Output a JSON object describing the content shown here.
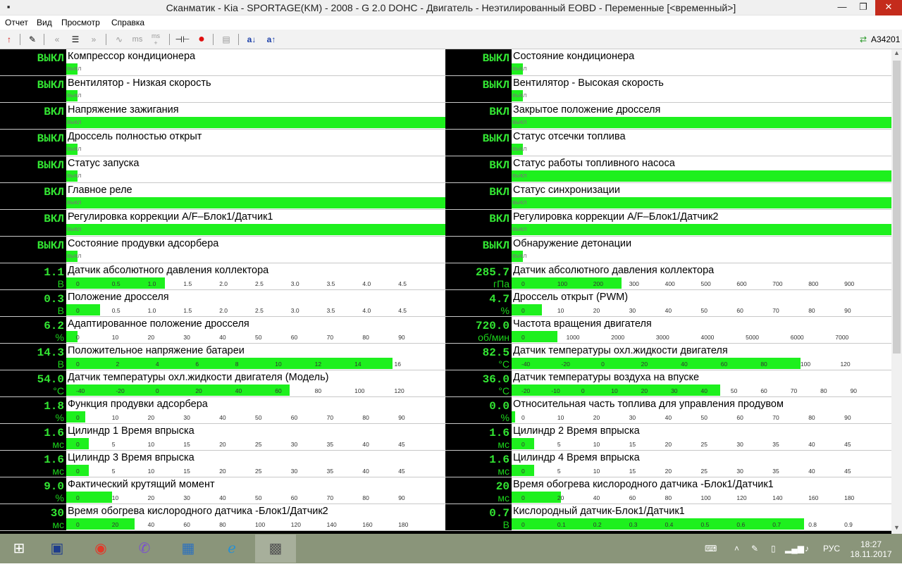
{
  "window": {
    "title": "Сканматик - Kia - SPORTAGE(KM) - 2008 - G 2.0 DOHC - Двигатель - Неэтилированный EOBD - Переменные [<временный>]"
  },
  "menu": [
    "Отчет",
    "Вид",
    "Просмотр",
    "Справка"
  ],
  "toolbar": {
    "icons": [
      "back-arrow-icon",
      "edit-icon",
      "rewind-icon",
      "list-icon",
      "forward-icon",
      "wave-icon",
      "ms-icon",
      "ms-plus-icon",
      "connector-icon",
      "record-icon",
      "save-icon",
      "sort-down-icon",
      "sort-up-icon"
    ],
    "ms_label": "ms",
    "ms_plus_label": "ms\n+",
    "sort_down_label": "a↓",
    "sort_up_label": "a↑",
    "device_id": "A34201"
  },
  "colors": {
    "value_green": "#33e633",
    "bar_green": "#1ef01e",
    "panel_bg": "#000000"
  },
  "left": [
    {
      "value": "ВЫКЛ",
      "unit": "",
      "label": "Компрессор кондиционера",
      "type": "bool",
      "level": 0.03,
      "state": "выкл"
    },
    {
      "value": "ВЫКЛ",
      "unit": "",
      "label": "Вентилятор - Низкая скорость",
      "type": "bool",
      "level": 0.03,
      "state": "выкл"
    },
    {
      "value": "ВКЛ",
      "unit": "",
      "label": "Напряжение зажигания",
      "type": "bool",
      "level": 1,
      "state": "выкл"
    },
    {
      "value": "ВЫКЛ",
      "unit": "",
      "label": "Дроссель полностью открыт",
      "type": "bool",
      "level": 0.03,
      "state": "выкл"
    },
    {
      "value": "ВЫКЛ",
      "unit": "",
      "label": "Статус запуска",
      "type": "bool",
      "level": 0.03,
      "state": "выкл"
    },
    {
      "value": "ВКЛ",
      "unit": "",
      "label": "Главное реле",
      "type": "bool",
      "level": 1,
      "state": "выкл"
    },
    {
      "value": "ВКЛ",
      "unit": "",
      "label": "Регулировка коррекции A/F–Блок1/Датчик1",
      "type": "bool",
      "level": 1,
      "state": "выкл"
    },
    {
      "value": "ВЫКЛ",
      "unit": "",
      "label": "Состояние продувки адсорбера",
      "type": "bool",
      "level": 0.03,
      "state": "выкл"
    },
    {
      "value": "1.1",
      "unit": "В",
      "label": "Датчик абсолютного давления коллектора",
      "type": "scale",
      "level": 0.26,
      "ticks": [
        "0",
        "0.5",
        "1.0",
        "1.5",
        "2.0",
        "2.5",
        "3.0",
        "3.5",
        "4.0",
        "4.5"
      ]
    },
    {
      "value": "0.3",
      "unit": "В",
      "label": "Положение дросселя",
      "type": "scale",
      "level": 0.09,
      "ticks": [
        "0",
        "0.5",
        "1.0",
        "1.5",
        "2.0",
        "2.5",
        "3.0",
        "3.5",
        "4.0",
        "4.5"
      ]
    },
    {
      "value": "6.2",
      "unit": "%",
      "label": "Адаптированное положение дросселя",
      "type": "scale",
      "level": 0.03,
      "ticks": [
        "0",
        "10",
        "20",
        "30",
        "40",
        "50",
        "60",
        "70",
        "80",
        "90"
      ]
    },
    {
      "value": "14.3",
      "unit": "В",
      "label": "Положительное напряжение батареи",
      "type": "scale",
      "level": 0.86,
      "ticks": [
        "0",
        "2",
        "4",
        "6",
        "8",
        "10",
        "12",
        "14",
        "16"
      ]
    },
    {
      "value": "54.0",
      "unit": "°C",
      "label": "Датчик температуры охл.жидкости двигателя (Модель)",
      "type": "scale",
      "level": 0.59,
      "ticks": [
        "-40",
        "-20",
        "0",
        "20",
        "40",
        "60",
        "80",
        "100",
        "120"
      ]
    },
    {
      "value": "1.8",
      "unit": "%",
      "label": "Функция продувки адсорбера",
      "type": "scale",
      "level": 0.05,
      "ticks": [
        "0",
        "10",
        "20",
        "30",
        "40",
        "50",
        "60",
        "70",
        "80",
        "90"
      ]
    },
    {
      "value": "1.6",
      "unit": "мс",
      "label": "Цилиндр 1 Время впрыска",
      "type": "scale",
      "level": 0.06,
      "ticks": [
        "0",
        "5",
        "10",
        "15",
        "20",
        "25",
        "30",
        "35",
        "40",
        "45"
      ]
    },
    {
      "value": "1.6",
      "unit": "мс",
      "label": "Цилиндр 3 Время впрыска",
      "type": "scale",
      "level": 0.06,
      "ticks": [
        "0",
        "5",
        "10",
        "15",
        "20",
        "25",
        "30",
        "35",
        "40",
        "45"
      ]
    },
    {
      "value": "9.0",
      "unit": "%",
      "label": "Фактический крутящий момент",
      "type": "scale",
      "level": 0.12,
      "ticks": [
        "0",
        "10",
        "20",
        "30",
        "40",
        "50",
        "60",
        "70",
        "80",
        "90"
      ]
    },
    {
      "value": "30",
      "unit": "мс",
      "label": "Время обогрева кислородного датчика -Блок1/Датчик2",
      "type": "scale",
      "level": 0.18,
      "ticks": [
        "0",
        "20",
        "40",
        "60",
        "80",
        "100",
        "120",
        "140",
        "160",
        "180"
      ]
    }
  ],
  "right": [
    {
      "value": "ВЫКЛ",
      "unit": "",
      "label": "Состояние кондиционера",
      "type": "bool",
      "level": 0.03,
      "state": "выкл"
    },
    {
      "value": "ВЫКЛ",
      "unit": "",
      "label": "Вентилятор - Высокая скорость",
      "type": "bool",
      "level": 0.03,
      "state": "выкл"
    },
    {
      "value": "ВКЛ",
      "unit": "",
      "label": "Закрытое положение дросселя",
      "type": "bool",
      "level": 1,
      "state": "выкл"
    },
    {
      "value": "ВЫКЛ",
      "unit": "",
      "label": "Статус отсечки топлива",
      "type": "bool",
      "level": 0.03,
      "state": "выкл"
    },
    {
      "value": "ВКЛ",
      "unit": "",
      "label": "Статус работы топливного насоса",
      "type": "bool",
      "level": 1,
      "state": "выкл"
    },
    {
      "value": "ВКЛ",
      "unit": "",
      "label": "Статус синхронизации",
      "type": "bool",
      "level": 1,
      "state": "выкл"
    },
    {
      "value": "ВКЛ",
      "unit": "",
      "label": "Регулировка коррекции A/F–Блок1/Датчик2",
      "type": "bool",
      "level": 1,
      "state": "выкл"
    },
    {
      "value": "ВЫКЛ",
      "unit": "",
      "label": "Обнаружение детонации",
      "type": "bool",
      "level": 0.03,
      "state": "выкл"
    },
    {
      "value": "285.7",
      "unit": "гПа",
      "label": "Датчик абсолютного давления коллектора",
      "type": "scale",
      "level": 0.29,
      "ticks": [
        "0",
        "100",
        "200",
        "300",
        "400",
        "500",
        "600",
        "700",
        "800",
        "900"
      ]
    },
    {
      "value": "4.7",
      "unit": "%",
      "label": "Дроссель открыт (PWM)",
      "type": "scale",
      "level": 0.08,
      "ticks": [
        "0",
        "10",
        "20",
        "30",
        "40",
        "50",
        "60",
        "70",
        "80",
        "90"
      ]
    },
    {
      "value": "720.0",
      "unit": "об/мин",
      "label": "Частота вращения двигателя",
      "type": "scale",
      "level": 0.12,
      "ticks": [
        "0",
        "1000",
        "2000",
        "3000",
        "4000",
        "5000",
        "6000",
        "7000"
      ]
    },
    {
      "value": "82.5",
      "unit": "°C",
      "label": "Датчик температуры охл.жидкости двигателя",
      "type": "scale",
      "level": 0.76,
      "ticks": [
        "-40",
        "-20",
        "0",
        "20",
        "40",
        "60",
        "80",
        "100",
        "120"
      ]
    },
    {
      "value": "36.0",
      "unit": "°C",
      "label": "Датчик температуры воздуха на впуске",
      "type": "scale",
      "level": 0.55,
      "ticks": [
        "-20",
        "-10",
        "0",
        "10",
        "20",
        "30",
        "40",
        "50",
        "60",
        "70",
        "80",
        "90"
      ]
    },
    {
      "value": "0.0",
      "unit": "%",
      "label": "Относительная часть топлива для управления продувом",
      "type": "scale",
      "level": 0.01,
      "ticks": [
        "0",
        "10",
        "20",
        "30",
        "40",
        "50",
        "60",
        "70",
        "80",
        "90"
      ]
    },
    {
      "value": "1.6",
      "unit": "мс",
      "label": "Цилиндр 2 Время впрыска",
      "type": "scale",
      "level": 0.06,
      "ticks": [
        "0",
        "5",
        "10",
        "15",
        "20",
        "25",
        "30",
        "35",
        "40",
        "45"
      ]
    },
    {
      "value": "1.6",
      "unit": "мс",
      "label": "Цилиндр 4 Время впрыска",
      "type": "scale",
      "level": 0.06,
      "ticks": [
        "0",
        "5",
        "10",
        "15",
        "20",
        "25",
        "30",
        "35",
        "40",
        "45"
      ]
    },
    {
      "value": "20",
      "unit": "мс",
      "label": "Время обогрева кислородного датчика -Блок1/Датчик1",
      "type": "scale",
      "level": 0.13,
      "ticks": [
        "0",
        "20",
        "40",
        "60",
        "80",
        "100",
        "120",
        "140",
        "160",
        "180"
      ]
    },
    {
      "value": "0.7",
      "unit": "В",
      "label": "Кислородный датчик-Блок1/Датчик1",
      "type": "scale",
      "level": 0.77,
      "ticks": [
        "0",
        "0.1",
        "0.2",
        "0.3",
        "0.4",
        "0.5",
        "0.6",
        "0.7",
        "0.8",
        "0.9"
      ]
    }
  ],
  "taskbar": {
    "apps": [
      "windows-logo-icon",
      "save-disk-icon",
      "chrome-icon",
      "viber-icon",
      "network-drive-icon",
      "ie-icon",
      "scanmatik-icon"
    ],
    "lang": "РУС",
    "time": "18:27",
    "date": "18.11.2017"
  }
}
